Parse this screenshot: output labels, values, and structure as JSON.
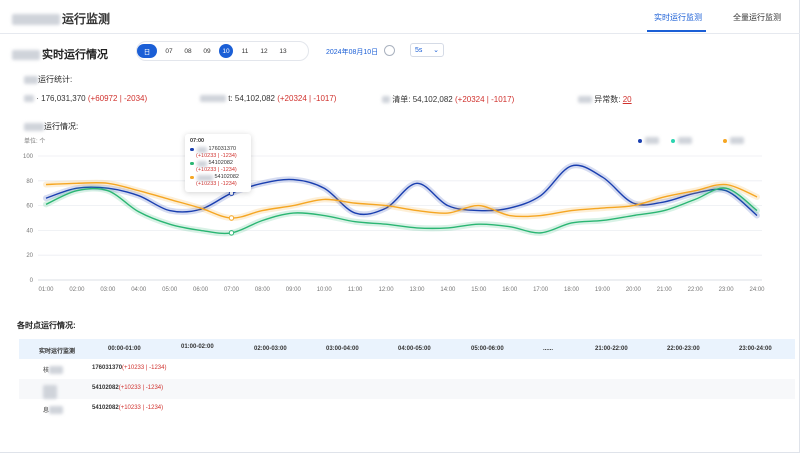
{
  "header": {
    "title": "运行监测",
    "tabs": [
      {
        "label": "实时运行监测",
        "active": true
      },
      {
        "label": "全量运行监测",
        "active": false
      }
    ]
  },
  "realtime": {
    "title": "实时运行情况",
    "chips": [
      "日",
      "07",
      "08",
      "09",
      "10",
      "11",
      "12",
      "13"
    ],
    "active_chips": [
      "日",
      "10"
    ],
    "date": "2024年08月10日",
    "interval": "5s"
  },
  "stats": {
    "title": "运行统计:",
    "items": [
      {
        "label": "·",
        "value": "176,031,370",
        "inc": "(+60972",
        "sep": " | ",
        "dec": "-2034)"
      },
      {
        "label": "t:",
        "value": "54,102,082",
        "inc": "(+20324",
        "sep": " | ",
        "dec": "-1017)"
      },
      {
        "label": "清单:",
        "value": "54,102,082",
        "inc": "(+20324",
        "sep": " | ",
        "dec": "-1017)"
      },
      {
        "label": "异常数:",
        "value": "20"
      }
    ]
  },
  "run": {
    "title": "运行情况:",
    "unit": "单位: 个"
  },
  "tooltip": {
    "time": "07:00",
    "rows": [
      {
        "label": "176031370",
        "sub": "(+10233 | -1234)",
        "color": "#1a3fb0"
      },
      {
        "label": "54102082",
        "sub": "(+10233 | -1234)",
        "color": "#2bb673"
      },
      {
        "label": "54102082",
        "sub": "(+10233 | -1234)",
        "color": "#f5a623"
      }
    ]
  },
  "chart_data": {
    "type": "line",
    "x": [
      "01:00",
      "02:00",
      "03:00",
      "04:00",
      "05:00",
      "06:00",
      "07:00",
      "08:00",
      "09:00",
      "10:00",
      "11:00",
      "12:00",
      "13:00",
      "14:00",
      "15:00",
      "16:00",
      "17:00",
      "18:00",
      "19:00",
      "20:00",
      "21:00",
      "22:00",
      "23:00",
      "24:00"
    ],
    "ylim": [
      0,
      100
    ],
    "yticks": [
      0,
      20,
      40,
      60,
      80,
      100
    ],
    "ytick_labels": [
      "0",
      "20",
      "40",
      "60",
      "80",
      "100"
    ],
    "series": [
      {
        "color": "#1a3fb0",
        "values": [
          66,
          74,
          74,
          68,
          56,
          57,
          70,
          78,
          81,
          74,
          54,
          58,
          78,
          60,
          56,
          58,
          68,
          92,
          83,
          62,
          63,
          70,
          72,
          52
        ]
      },
      {
        "color": "#2bb673",
        "values": [
          61,
          72,
          72,
          55,
          45,
          40,
          38,
          48,
          54,
          52,
          47,
          45,
          42,
          42,
          45,
          43,
          38,
          46,
          48,
          52,
          56,
          65,
          74,
          56
        ]
      },
      {
        "color": "#f5a623",
        "values": [
          77,
          78,
          78,
          72,
          65,
          58,
          50,
          56,
          60,
          65,
          62,
          60,
          56,
          54,
          60,
          52,
          52,
          56,
          58,
          60,
          67,
          72,
          77,
          67
        ]
      }
    ],
    "grid": true
  },
  "hours": {
    "title": "各时点运行情况:",
    "columns": [
      "实时运行监测",
      "00:00-01:00",
      "01:00-02:00",
      "02:00-03:00",
      "03:00-04:00",
      "04:00-05:00",
      "05:00-06:00",
      "......",
      "21:00-22:00",
      "22:00-23:00",
      "23:00-24:00"
    ],
    "rows": [
      {
        "name": "核",
        "value": "176031370",
        "delta": "(+10233 | -1234)"
      },
      {
        "name": "",
        "value": "54102082",
        "delta": "(+10233 | -1234)"
      },
      {
        "name": "息",
        "value": "54102082",
        "delta": "(+10233 | -1234)"
      }
    ]
  },
  "colors": {
    "accent": "#1b5fd6",
    "negative": "#d0312d"
  }
}
